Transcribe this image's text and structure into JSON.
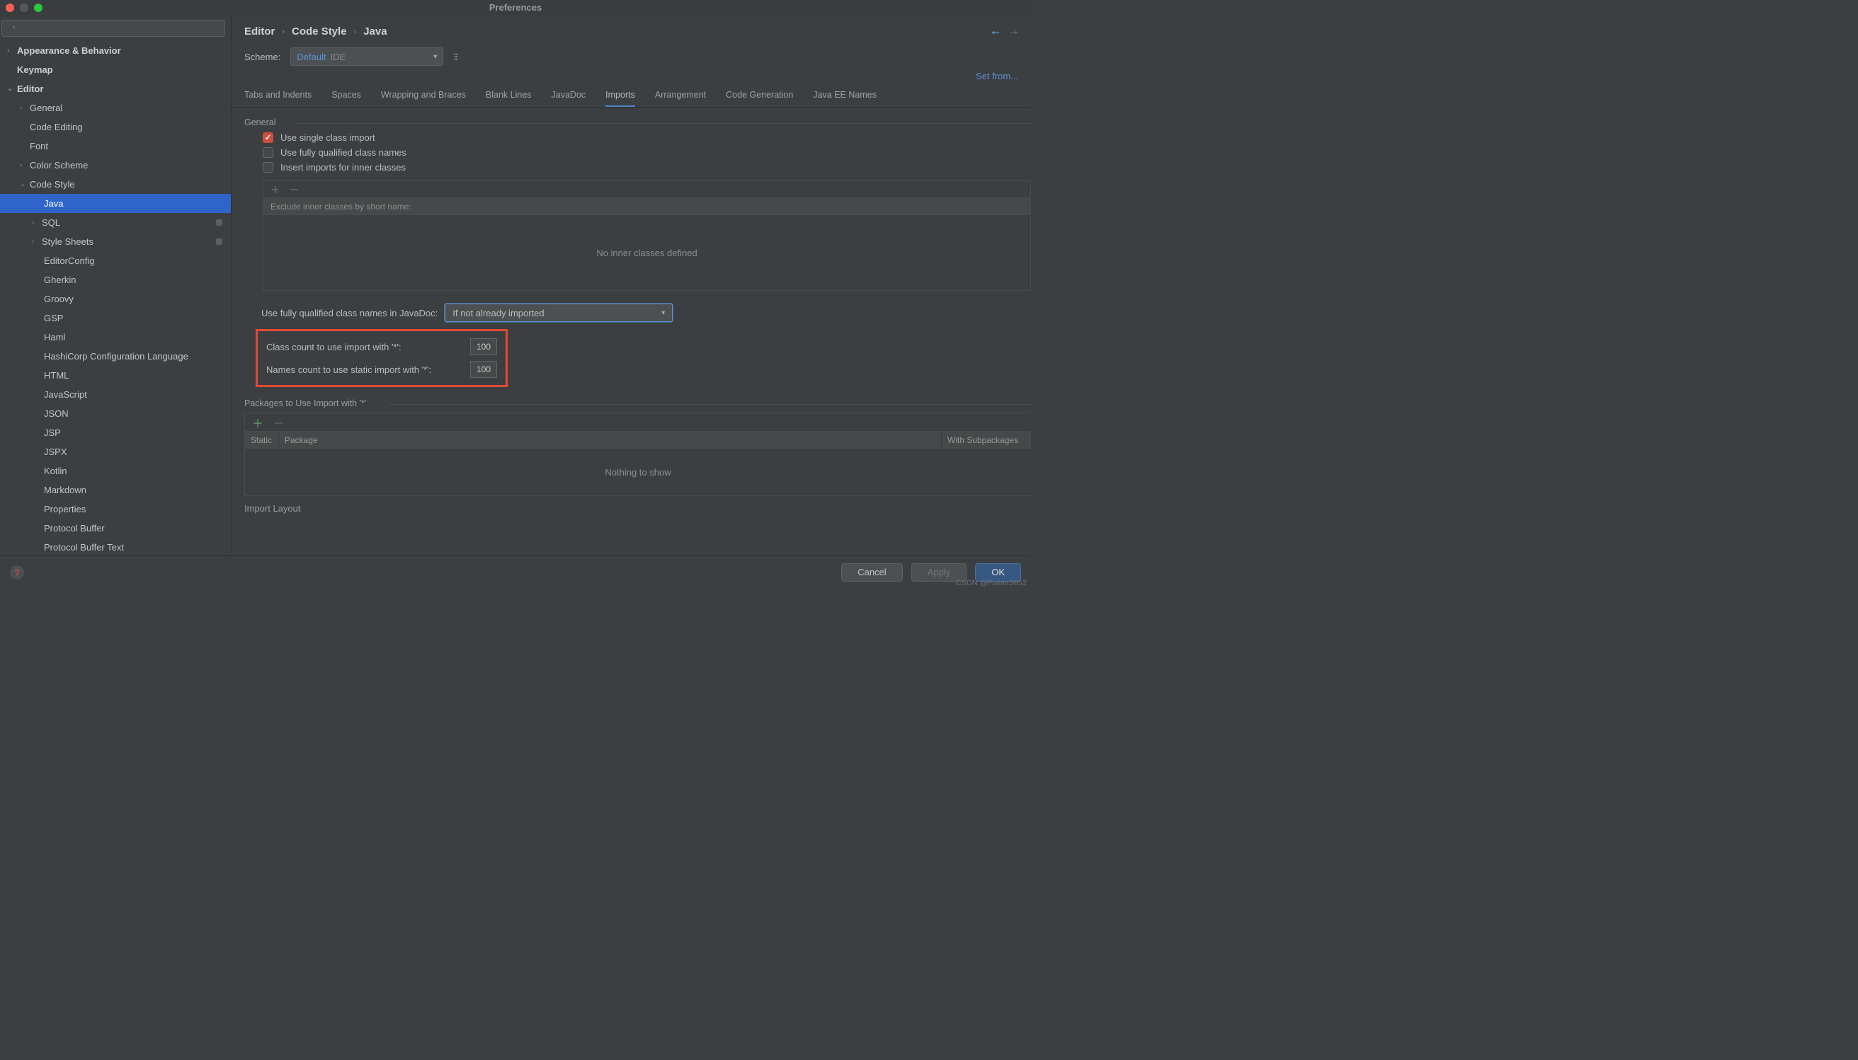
{
  "title": "Preferences",
  "search": {
    "placeholder": ""
  },
  "tree": {
    "appearance": "Appearance & Behavior",
    "keymap": "Keymap",
    "editor": "Editor",
    "general": "General",
    "code_editing": "Code Editing",
    "font": "Font",
    "color_scheme": "Color Scheme",
    "code_style": "Code Style",
    "java": "Java",
    "sql": "SQL",
    "style_sheets": "Style Sheets",
    "editorconfig": "EditorConfig",
    "gherkin": "Gherkin",
    "groovy": "Groovy",
    "gsp": "GSP",
    "haml": "Haml",
    "hashicorp": "HashiCorp Configuration Language",
    "html": "HTML",
    "javascript": "JavaScript",
    "json": "JSON",
    "jsp": "JSP",
    "jspx": "JSPX",
    "kotlin": "Kotlin",
    "markdown": "Markdown",
    "properties": "Properties",
    "protobuf": "Protocol Buffer",
    "protobuf_text": "Protocol Buffer Text"
  },
  "breadcrumb": {
    "a": "Editor",
    "b": "Code Style",
    "c": "Java"
  },
  "scheme": {
    "label": "Scheme:",
    "name": "Default",
    "scope": "IDE"
  },
  "set_from": "Set from...",
  "tabs": {
    "tabs_indents": "Tabs and Indents",
    "spaces": "Spaces",
    "wrapping": "Wrapping and Braces",
    "blank": "Blank Lines",
    "javadoc": "JavaDoc",
    "imports": "Imports",
    "arrangement": "Arrangement",
    "codegen": "Code Generation",
    "javaee": "Java EE Names"
  },
  "general": {
    "label": "General",
    "use_single": "Use single class import",
    "use_fqcn": "Use fully qualified class names",
    "insert_inner": "Insert imports for inner classes",
    "exclude_header": "Exclude inner classes by short name:",
    "no_inner": "No inner classes defined"
  },
  "fqcn_row": {
    "label": "Use fully qualified class names in JavaDoc:",
    "value": "If not already imported"
  },
  "counts": {
    "class_label": "Class count to use import with '*':",
    "class_value": "100",
    "names_label": "Names count to use static import with '*':",
    "names_value": "100"
  },
  "packages": {
    "title": "Packages to Use Import with '*'",
    "col_static": "Static",
    "col_package": "Package",
    "col_sub": "With Subpackages",
    "empty": "Nothing to show"
  },
  "import_layout": "Import Layout",
  "footer": {
    "cancel": "Cancel",
    "apply": "Apply",
    "ok": "OK"
  },
  "watermark": "CSDN @Fisher3652"
}
